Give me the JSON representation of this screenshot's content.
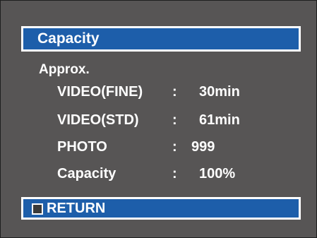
{
  "menu": {
    "title": "Capacity",
    "approx_label": "Approx.",
    "rows": [
      {
        "label": "VIDEO(FINE)",
        "separator": ":",
        "value": "30min"
      },
      {
        "label": "VIDEO(STD)",
        "separator": ":",
        "value": "61min"
      },
      {
        "label": "PHOTO",
        "separator": ":",
        "value": "999"
      },
      {
        "label": "Capacity",
        "separator": ":",
        "value": "100%"
      }
    ],
    "return_label": "RETURN",
    "return_icon": "stop-square-icon"
  },
  "colors": {
    "background": "#575555",
    "accent_blue": "#1d5eaa",
    "text": "#ffffff"
  }
}
